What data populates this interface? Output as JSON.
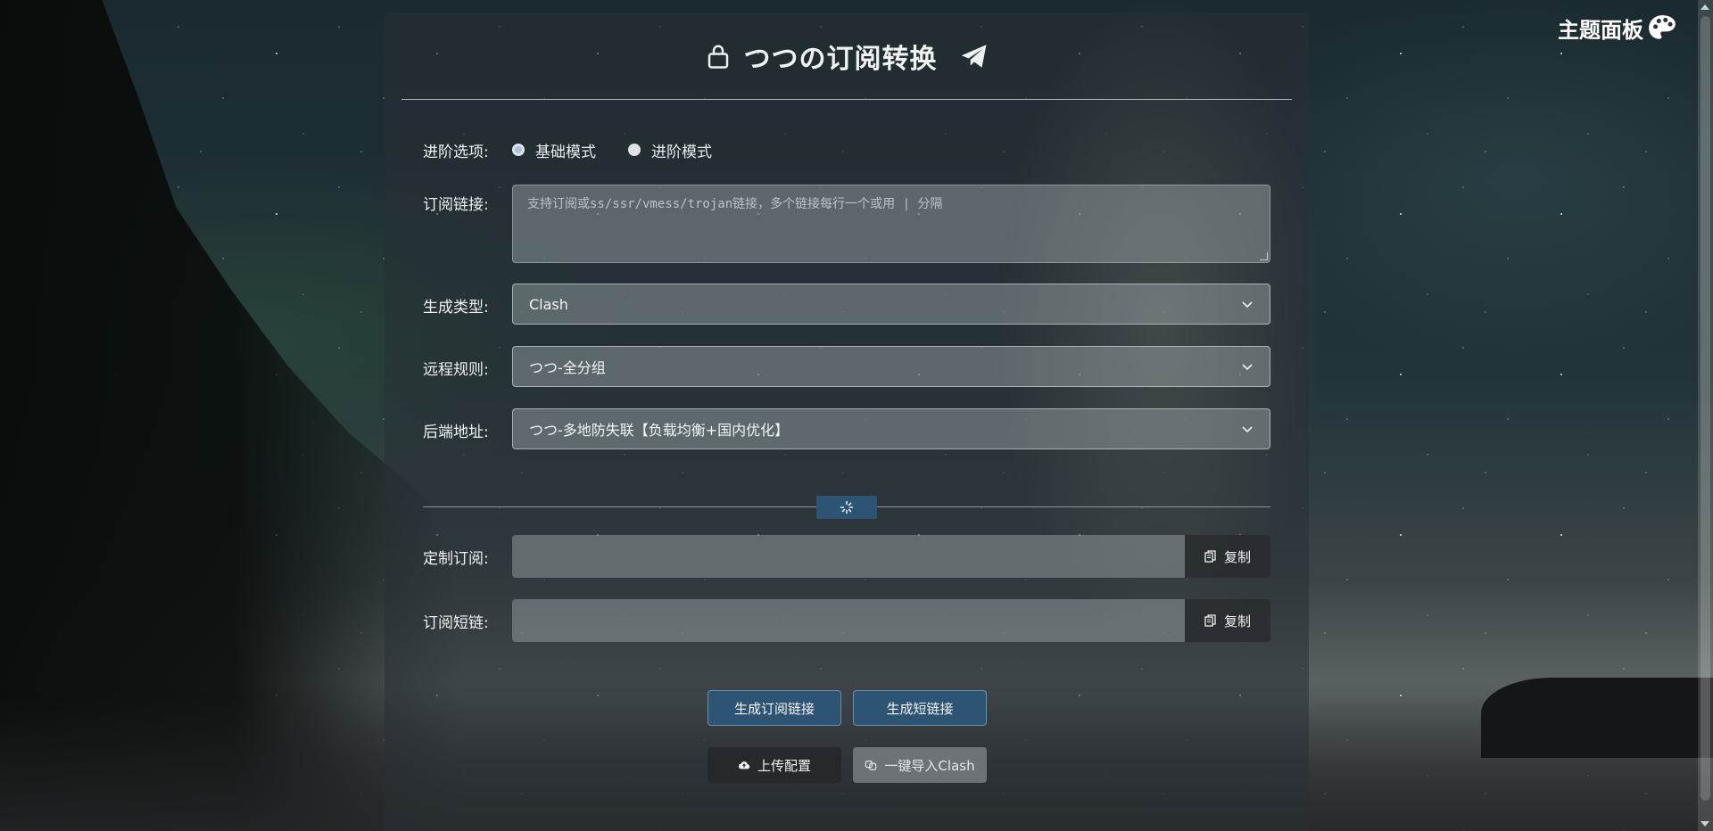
{
  "header": {
    "title": "つつの订阅转换"
  },
  "theme_panel": {
    "label": "主题面板"
  },
  "form": {
    "mode": {
      "label": "进阶选项:",
      "options": [
        "基础模式",
        "进阶模式"
      ],
      "selected": "基础模式"
    },
    "subscription": {
      "label": "订阅链接:",
      "placeholder": "支持订阅或ss/ssr/vmess/trojan链接，多个链接每行一个或用 | 分隔",
      "value": ""
    },
    "target_type": {
      "label": "生成类型:",
      "value": "Clash"
    },
    "remote_config": {
      "label": "远程规则:",
      "value": "つつ-全分组"
    },
    "backend": {
      "label": "后端地址:",
      "value": "つつ-多地防失联【负载均衡+国内优化】"
    }
  },
  "outputs": {
    "custom_sub": {
      "label": "定制订阅:",
      "value": "",
      "copy_label": "复制"
    },
    "short_link": {
      "label": "订阅短链:",
      "value": "",
      "copy_label": "复制"
    }
  },
  "actions": {
    "generate_sub": "生成订阅链接",
    "generate_short": "生成短链接",
    "upload_config": "上传配置",
    "import_clash": "一键导入Clash"
  },
  "colors": {
    "primary_button": "#2e5473",
    "card_bg": "rgba(40,48,52,0.55)"
  },
  "icons": {
    "title_left": "lock-icon",
    "title_right": "telegram-icon",
    "theme": "palette-icon",
    "divider": "spinner-icon",
    "copy": "copy-icon",
    "upload": "cloud-upload-icon",
    "import": "link-icon"
  }
}
